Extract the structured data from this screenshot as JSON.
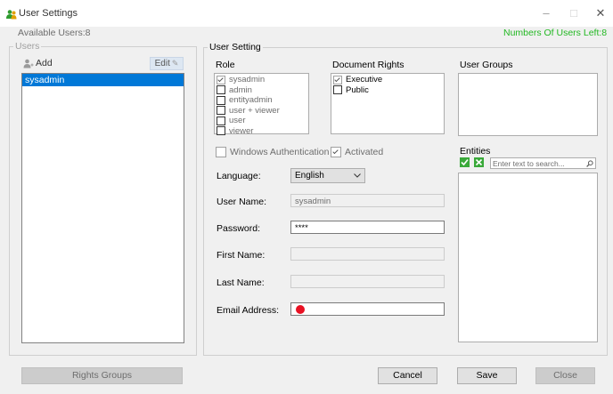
{
  "window": {
    "title": "User Settings",
    "controls": {
      "minimize": "–",
      "maximize": "□",
      "close": "✕"
    }
  },
  "header": {
    "available_users": "Available Users:8",
    "users_left": "Numbers Of Users Left:8"
  },
  "users_panel": {
    "legend": "Users",
    "add_label": "Add",
    "edit_label": "Edit",
    "users": [
      "sysadmin"
    ]
  },
  "user_setting": {
    "legend": "User Setting",
    "role_header": "Role",
    "roles": [
      {
        "label": "sysadmin",
        "checked": true
      },
      {
        "label": "admin",
        "checked": false
      },
      {
        "label": "entityadmin",
        "checked": false
      },
      {
        "label": "user + viewer",
        "checked": false
      },
      {
        "label": "user",
        "checked": false
      },
      {
        "label": "viewer",
        "checked": false
      }
    ],
    "doc_rights_header": "Document Rights",
    "doc_rights": [
      {
        "label": "Executive",
        "checked": true
      },
      {
        "label": "Public",
        "checked": false
      }
    ],
    "user_groups_header": "User Groups",
    "windows_auth_label": "Windows Authentication",
    "activated_label": "Activated",
    "language_label": "Language:",
    "language_value": "English",
    "username_label": "User Name:",
    "username_value": "sysadmin",
    "password_label": "Password:",
    "password_value": "****",
    "firstname_label": "First Name:",
    "lastname_label": "Last Name:",
    "email_label": "Email Address:",
    "entities_header": "Entities",
    "entities_search_placeholder": "Enter text to search..."
  },
  "footer": {
    "rights_groups": "Rights Groups",
    "cancel": "Cancel",
    "save": "Save",
    "close": "Close"
  },
  "colors": {
    "accent": "#0078d7",
    "users_left": "#22b822",
    "error": "#e81123"
  }
}
